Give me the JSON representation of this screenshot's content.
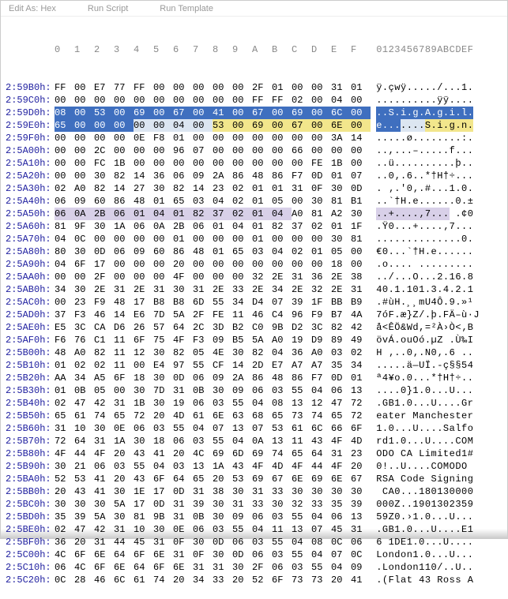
{
  "toolbar": {
    "a": "Edit As: Hex",
    "b": "Run Script",
    "c": "Run Template"
  },
  "header": {
    "cols": "0  1  2  3  4  5  6  7  8  9  A  B  C  D  E  F",
    "ascii": "0123456789ABCDEF"
  },
  "rows": [
    {
      "off": "2:59B0h:",
      "p": [
        {
          "t": "FF 00 E7 77 FF 00 00 00 00 00 2F 01 00 00 31 01"
        }
      ],
      "a": [
        {
          "t": "ÿ.çwÿ...../...1."
        }
      ]
    },
    {
      "off": "2:59C0h:",
      "p": [
        {
          "t": "00 00 00 00 00 00 00 00 00 00 FF FF 02 00 04 00"
        }
      ],
      "a": [
        {
          "t": "..........ÿÿ...."
        }
      ]
    },
    {
      "off": "2:59D0h:",
      "p": [
        {
          "t": "08 00 53 00 69 00 67 00 41 00 67 00 69 00 6C 00",
          "c": "hl-blue-b"
        }
      ],
      "a": [
        {
          "t": "..S.i.g.A.g.i.l.",
          "c": "hl-blue-b"
        }
      ]
    },
    {
      "off": "2:59E0h:",
      "p": [
        {
          "t": "65 00 00 00 ",
          "c": "hl-blue-b"
        },
        {
          "t": "00 00 04 00 ",
          "c": "hl-blue-a"
        },
        {
          "t": "53 00 69 00 67 00 6E 00",
          "c": "hl-yellow-b"
        }
      ],
      "a": [
        {
          "t": "e...",
          "c": "hl-blue-b"
        },
        {
          "t": "....",
          "c": "hl-blue-a"
        },
        {
          "t": "S.i.g.n.",
          "c": "hl-yellow-b"
        }
      ]
    },
    {
      "off": "2:59F0h:",
      "p": [
        {
          "t": "00 00 00 00 0E F8 01 00 00 00 00 00 00 00 3A 14"
        }
      ],
      "a": [
        {
          "t": ".....ø........:."
        }
      ]
    },
    {
      "off": "2:5A00h:",
      "p": [
        {
          "t": "00 00 2C 00 00 00 96 07 00 00 00 00 66 00 00 00"
        }
      ],
      "a": [
        {
          "t": "..,...–.....f..."
        }
      ]
    },
    {
      "off": "2:5A10h:",
      "p": [
        {
          "t": "00 00 FC 1B 00 00 00 00 00 00 00 00 00 FE 1B 00"
        }
      ],
      "a": [
        {
          "t": "..ü..........þ.."
        }
      ]
    },
    {
      "off": "2:5A20h:",
      "p": [
        {
          "t": "00 00 30 82 14 36 06 09 2A 86 48 86 F7 0D 01 07"
        }
      ],
      "a": [
        {
          "t": "..0‚.6..*†H†÷..."
        }
      ]
    },
    {
      "off": "2:5A30h:",
      "p": [
        {
          "t": "02 A0 82 14 27 30 82 14 23 02 01 01 31 0F 30 0D"
        }
      ],
      "a": [
        {
          "t": ". ‚.'0‚.#...1.0."
        }
      ]
    },
    {
      "off": "2:5A40h:",
      "p": [
        {
          "t": "06 09 60 86 48 01 65 03 04 02 01 05 00 30 81 B1"
        }
      ],
      "a": [
        {
          "t": "..`†H.e......0.±"
        }
      ]
    },
    {
      "off": "2:5A50h:",
      "p": [
        {
          "t": "06 0A 2B 06 01 04 01 82 37 02 01 04 ",
          "c": "hl-purple-b"
        },
        {
          "t": "A0 81 A2 30"
        }
      ],
      "a": [
        {
          "t": "..+....‚7...",
          "c": "hl-purple-b"
        },
        {
          "t": " .¢0"
        }
      ]
    },
    {
      "off": "2:5A60h:",
      "p": [
        {
          "t": "81 9F 30 1A 06 0A 2B 06 01 04 01 82 37 02 01 1F"
        }
      ],
      "a": [
        {
          "t": ".Ÿ0...+....‚7..."
        }
      ]
    },
    {
      "off": "2:5A70h:",
      "p": [
        {
          "t": "04 0C 00 00 00 00 01 00 00 00 01 00 00 00 30 81"
        }
      ],
      "a": [
        {
          "t": "..............0."
        }
      ]
    },
    {
      "off": "2:5A80h:",
      "p": [
        {
          "t": "80 30 0D 06 09 60 86 48 01 65 03 04 02 01 05 00"
        }
      ],
      "a": [
        {
          "t": "€0...`†H.e......"
        }
      ]
    },
    {
      "off": "2:5A90h:",
      "p": [
        {
          "t": "04 6F 17 00 00 00 20 00 00 00 00 00 00 00 18 00"
        }
      ],
      "a": [
        {
          "t": ".o.... ........."
        }
      ]
    },
    {
      "off": "2:5AA0h:",
      "p": [
        {
          "t": "00 00 2F 00 00 00 4F 00 00 00 32 2E 31 36 2E 38"
        }
      ],
      "a": [
        {
          "t": "../...O...2.16.8"
        }
      ]
    },
    {
      "off": "2:5AB0h:",
      "p": [
        {
          "t": "34 30 2E 31 2E 31 30 31 2E 33 2E 34 2E 32 2E 31"
        }
      ],
      "a": [
        {
          "t": "40.1.101.3.4.2.1"
        }
      ]
    },
    {
      "off": "2:5AC0h:",
      "p": [
        {
          "t": "00 23 F9 48 17 B8 B8 6D 55 34 D4 07 39 1F BB B9"
        }
      ],
      "a": [
        {
          "t": ".#ùH.¸¸mU4Ô.9.»¹"
        }
      ]
    },
    {
      "off": "2:5AD0h:",
      "p": [
        {
          "t": "37 F3 46 14 E6 7D 5A 2F FE 11 46 C4 96 F9 B7 4A"
        }
      ],
      "a": [
        {
          "t": "7óF.æ}Z/.þ.FÄ–ù·J"
        }
      ]
    },
    {
      "off": "2:5AE0h:",
      "p": [
        {
          "t": "E5 3C CA D6 26 57 64 2C 3D B2 C0 9B D2 3C 82 42"
        }
      ],
      "a": [
        {
          "t": "å<ÊÖ&Wd,=²À›Ò<‚B"
        }
      ]
    },
    {
      "off": "2:5AF0h:",
      "p": [
        {
          "t": "F6 76 C1 11 6F 75 4F F3 09 B5 5A A0 19 D9 89 49"
        }
      ],
      "a": [
        {
          "t": "övÁ.ouOó.µZ .Ù‰I"
        }
      ]
    },
    {
      "off": "2:5B00h:",
      "p": [
        {
          "t": "48 A0 82 11 12 30 82 05 4E 30 82 04 36 A0 03 02"
        }
      ],
      "a": [
        {
          "t": "H ‚..0‚.N0‚.6 .."
        }
      ]
    },
    {
      "off": "2:5B10h:",
      "p": [
        {
          "t": "01 02 02 11 00 E4 97 55 CF 14 2D E7 A7 A7 35 34"
        }
      ],
      "a": [
        {
          "t": ".....ä—UÏ.-ç§§54"
        }
      ]
    },
    {
      "off": "2:5B20h:",
      "p": [
        {
          "t": "AA 34 A5 6F 18 30 0D 06 09 2A 86 48 86 F7 0D 01"
        }
      ],
      "a": [
        {
          "t": "ª4¥o.0...*†H†÷.."
        }
      ]
    },
    {
      "off": "2:5B30h:",
      "p": [
        {
          "t": "01 0B 05 00 30 7D 31 0B 30 09 06 03 55 04 06 13"
        }
      ],
      "a": [
        {
          "t": "....0}1.0...U..."
        }
      ]
    },
    {
      "off": "2:5B40h:",
      "p": [
        {
          "t": "02 47 42 31 1B 30 19 06 03 55 04 08 13 12 47 72"
        }
      ],
      "a": [
        {
          "t": ".GB1.0...U....Gr"
        }
      ]
    },
    {
      "off": "2:5B50h:",
      "p": [
        {
          "t": "65 61 74 65 72 20 4D 61 6E 63 68 65 73 74 65 72"
        }
      ],
      "a": [
        {
          "t": "eater Manchester"
        }
      ]
    },
    {
      "off": "2:5B60h:",
      "p": [
        {
          "t": "31 10 30 0E 06 03 55 04 07 13 07 53 61 6C 66 6F"
        }
      ],
      "a": [
        {
          "t": "1.0...U....Salfo"
        }
      ]
    },
    {
      "off": "2:5B70h:",
      "p": [
        {
          "t": "72 64 31 1A 30 18 06 03 55 04 0A 13 11 43 4F 4D"
        }
      ],
      "a": [
        {
          "t": "rd1.0...U....COM"
        }
      ]
    },
    {
      "off": "2:5B80h:",
      "p": [
        {
          "t": "4F 44 4F 20 43 41 20 4C 69 6D 69 74 65 64 31 23"
        }
      ],
      "a": [
        {
          "t": "ODO CA Limited1#"
        }
      ]
    },
    {
      "off": "2:5B90h:",
      "p": [
        {
          "t": "30 21 06 03 55 04 03 13 1A 43 4F 4D 4F 44 4F 20"
        }
      ],
      "a": [
        {
          "t": "0!..U....COMODO "
        }
      ]
    },
    {
      "off": "2:5BA0h:",
      "p": [
        {
          "t": "52 53 41 20 43 6F 64 65 20 53 69 67 6E 69 6E 67"
        }
      ],
      "a": [
        {
          "t": "RSA Code Signing"
        }
      ]
    },
    {
      "off": "2:5BB0h:",
      "p": [
        {
          "t": "20 43 41 30 1E 17 0D 31 38 30 31 33 30 30 30 30"
        }
      ],
      "a": [
        {
          "t": " CA0...180130000"
        }
      ]
    },
    {
      "off": "2:5BC0h:",
      "p": [
        {
          "t": "30 30 30 5A 17 0D 31 39 30 31 33 30 32 33 35 39"
        }
      ],
      "a": [
        {
          "t": "000Z..1901302359"
        }
      ]
    },
    {
      "off": "2:5BD0h:",
      "p": [
        {
          "t": "35 39 5A 30 81 9B 31 0B 30 09 06 03 55 04 06 13"
        }
      ],
      "a": [
        {
          "t": "59Z0.›1.0...U..."
        }
      ]
    },
    {
      "off": "2:5BE0h:",
      "p": [
        {
          "t": "02 47 42 31 10 30 0E 06 03 55 04 11 13 07 45 31"
        }
      ],
      "a": [
        {
          "t": ".GB1.0...U....E1"
        }
      ]
    },
    {
      "off": "2:5BF0h:",
      "p": [
        {
          "t": "36 20 31 44 45 31 0F 30 0D 06 03 55 04 08 0C 06"
        }
      ],
      "a": [
        {
          "t": "6 1DE1.0...U...."
        }
      ]
    },
    {
      "off": "2:5C00h:",
      "p": [
        {
          "t": "4C 6F 6E 64 6F 6E 31 0F 30 0D 06 03 55 04 07 0C"
        }
      ],
      "a": [
        {
          "t": "London1.0...U..."
        }
      ]
    },
    {
      "off": "2:5C10h:",
      "p": [
        {
          "t": "06 4C 6F 6E 64 6F 6E 31 31 30 2F 06 03 55 04 09"
        }
      ],
      "a": [
        {
          "t": ".London110/..U.."
        }
      ]
    },
    {
      "off": "2:5C20h:",
      "p": [
        {
          "t": "0C 28 46 6C 61 74 20 34 33 20 52 6F 73 73 20 41"
        }
      ],
      "a": [
        {
          "t": ".(Flat 43 Ross A"
        }
      ]
    }
  ]
}
